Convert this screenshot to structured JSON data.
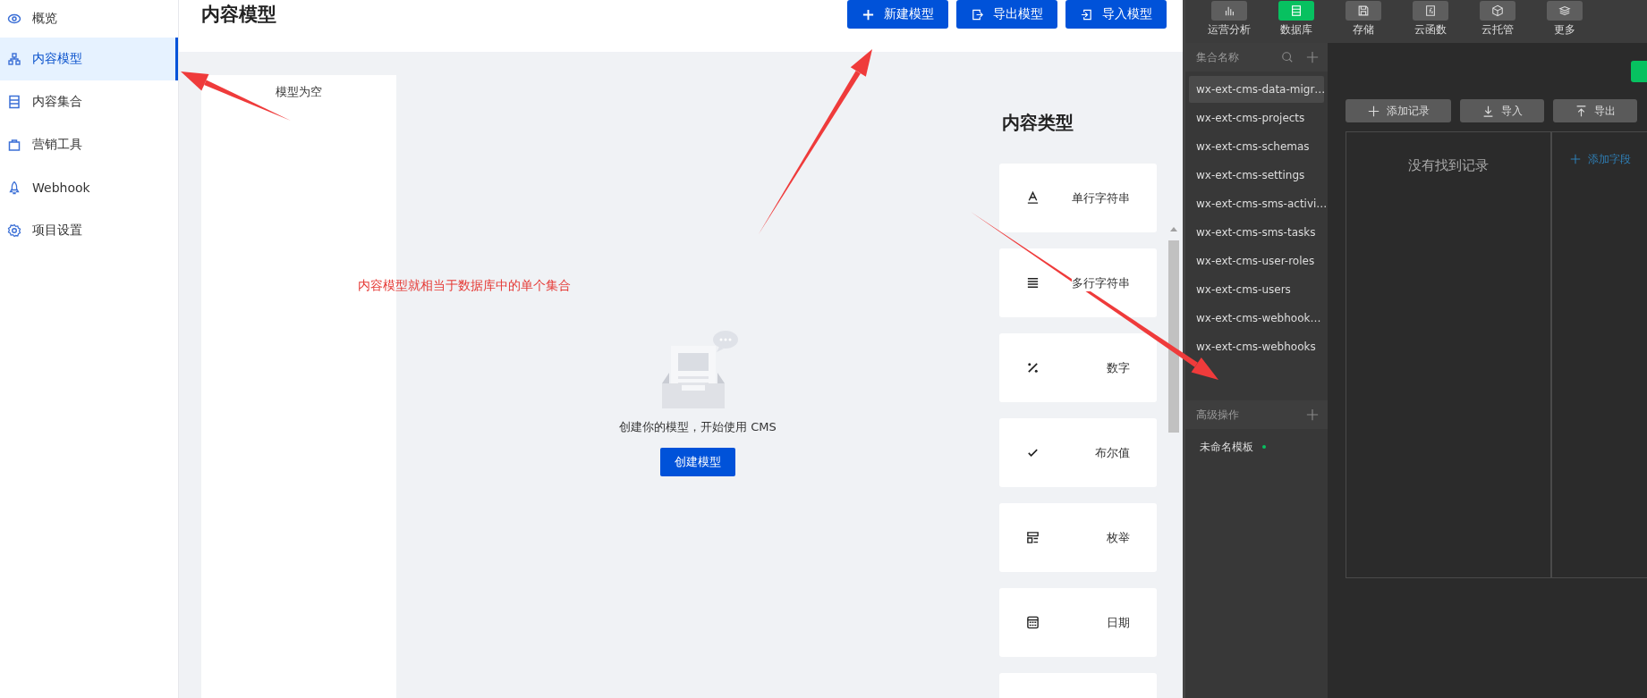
{
  "sidebar": {
    "items": [
      {
        "label": "概览",
        "selected": false
      },
      {
        "label": "内容模型",
        "selected": true
      },
      {
        "label": "内容集合",
        "selected": false
      },
      {
        "label": "营销工具",
        "selected": false
      },
      {
        "label": "Webhook",
        "selected": false
      },
      {
        "label": "项目设置",
        "selected": false
      }
    ]
  },
  "header": {
    "title": "内容模型",
    "buttons": [
      {
        "label": "新建模型"
      },
      {
        "label": "导出模型"
      },
      {
        "label": "导入模型"
      }
    ]
  },
  "model_list": {
    "empty_text": "模型为空"
  },
  "annotation": {
    "text": "内容模型就相当于数据库中的单个集合"
  },
  "empty_state": {
    "message": "创建你的模型，开始使用 CMS",
    "button": "创建模型"
  },
  "content_types": {
    "title": "内容类型",
    "items": [
      {
        "label": "单行字符串"
      },
      {
        "label": "多行字符串"
      },
      {
        "label": "数字"
      },
      {
        "label": "布尔值"
      },
      {
        "label": "枚举"
      },
      {
        "label": "日期"
      }
    ]
  },
  "db_panel": {
    "toolbar": [
      {
        "label": "运营分析",
        "selected": false
      },
      {
        "label": "数据库",
        "selected": true
      },
      {
        "label": "存储",
        "selected": false
      },
      {
        "label": "云函数",
        "selected": false
      },
      {
        "label": "云托管",
        "selected": false
      },
      {
        "label": "更多",
        "selected": false
      }
    ],
    "collections": {
      "header": "集合名称",
      "items": [
        {
          "label": "wx-ext-cms-data-migr…",
          "selected": true
        },
        {
          "label": "wx-ext-cms-projects",
          "selected": false
        },
        {
          "label": "wx-ext-cms-schemas",
          "selected": false
        },
        {
          "label": "wx-ext-cms-settings",
          "selected": false
        },
        {
          "label": "wx-ext-cms-sms-activi…",
          "selected": false
        },
        {
          "label": "wx-ext-cms-sms-tasks",
          "selected": false
        },
        {
          "label": "wx-ext-cms-user-roles",
          "selected": false
        },
        {
          "label": "wx-ext-cms-users",
          "selected": false
        },
        {
          "label": "wx-ext-cms-webhook…",
          "selected": false
        },
        {
          "label": "wx-ext-cms-webhooks",
          "selected": false
        }
      ]
    },
    "advanced": {
      "header": "高级操作",
      "items": [
        {
          "label": "未命名模板"
        }
      ]
    },
    "records": {
      "buttons": [
        {
          "label": "添加记录"
        },
        {
          "label": "导入"
        },
        {
          "label": "导出"
        }
      ],
      "empty_text": "没有找到记录",
      "add_field": "添加字段"
    }
  }
}
